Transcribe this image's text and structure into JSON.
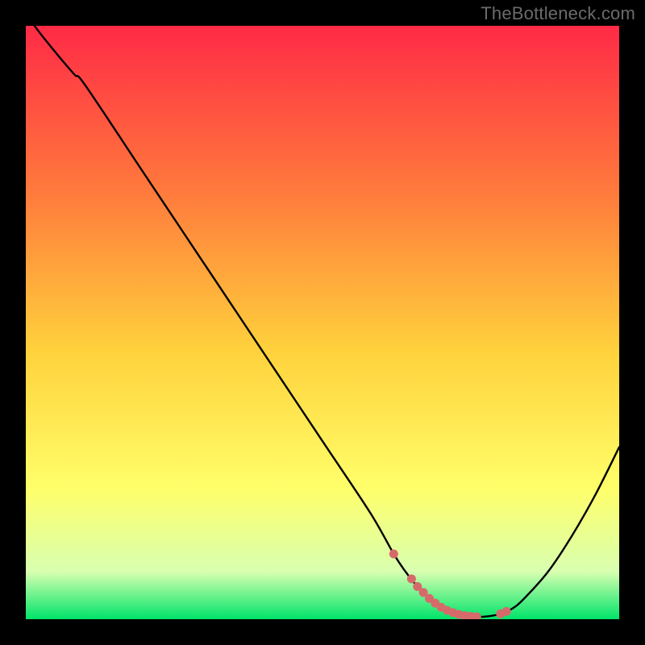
{
  "watermark": "TheBottleneck.com",
  "colors": {
    "gradient_top": "#ff2a46",
    "gradient_mid1": "#ff7a3c",
    "gradient_mid2": "#ffd23c",
    "gradient_mid3": "#ffff6a",
    "gradient_mid4": "#d8ffb0",
    "gradient_bottom": "#00e46a",
    "curve": "#000000",
    "dots": "#d66a6a"
  },
  "chart_data": {
    "type": "line",
    "title": "",
    "xlabel": "",
    "ylabel": "",
    "xlim": [
      0,
      100
    ],
    "ylim": [
      0,
      100
    ],
    "series": [
      {
        "name": "curve",
        "x": [
          0,
          3,
          8,
          10,
          20,
          30,
          40,
          50,
          58,
          62,
          64,
          66,
          68,
          70,
          72,
          74,
          76,
          78,
          80,
          82,
          84,
          88,
          92,
          96,
          100
        ],
        "y": [
          102,
          98,
          92,
          90,
          75,
          60,
          45,
          30,
          18,
          11,
          8,
          5.5,
          3.5,
          2,
          1.1,
          0.6,
          0.4,
          0.5,
          0.9,
          1.8,
          3.5,
          8,
          14,
          21,
          29
        ]
      }
    ],
    "dots": {
      "name": "highlight-dots",
      "x": [
        62,
        65,
        66,
        67,
        68,
        69,
        70,
        71,
        72,
        73,
        74,
        75,
        76,
        80,
        81
      ],
      "y": [
        11,
        6.8,
        5.5,
        4.5,
        3.5,
        2.7,
        2.0,
        1.5,
        1.1,
        0.8,
        0.6,
        0.5,
        0.4,
        0.9,
        1.3
      ]
    }
  }
}
